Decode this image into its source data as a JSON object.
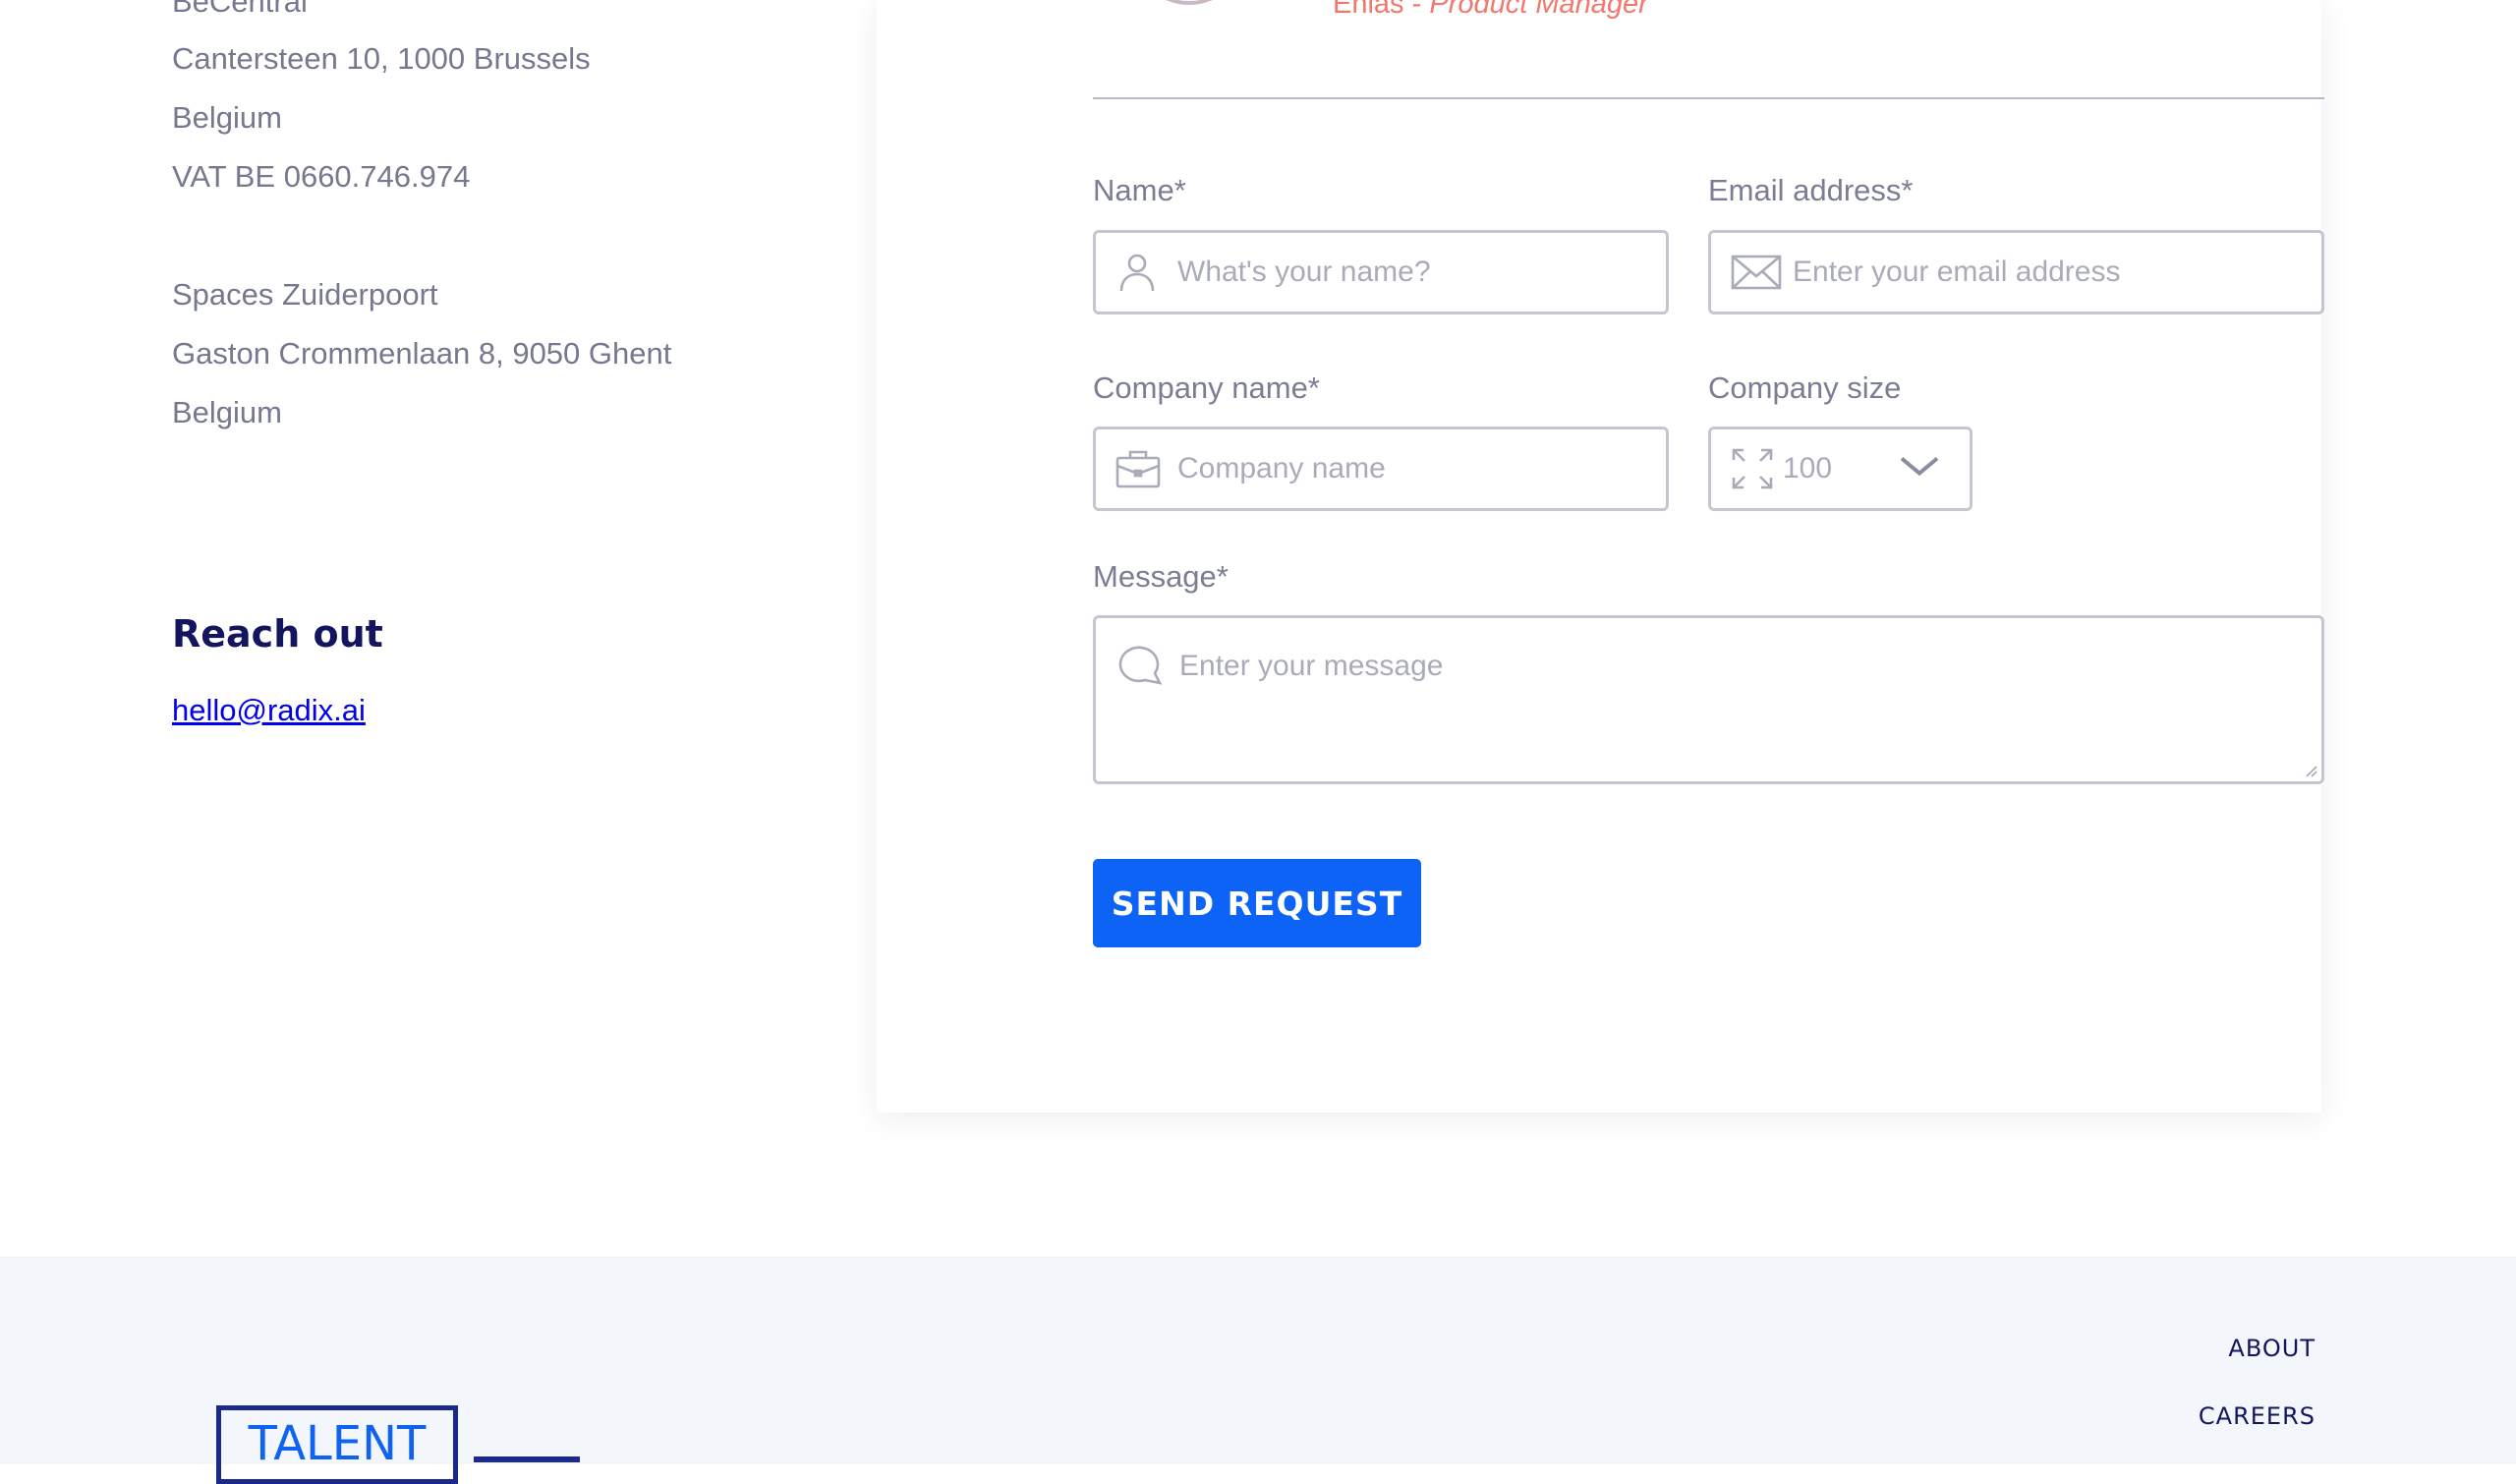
{
  "address": {
    "office1": [
      "BeCentral",
      "Cantersteen 10, 1000 Brussels",
      "Belgium",
      "VAT BE 0660.746.974"
    ],
    "office2": [
      "Spaces Zuiderpoort",
      "Gaston Crommenlaan 8, 9050 Ghent",
      "Belgium"
    ]
  },
  "reach_out": {
    "title": "Reach out",
    "email": "hello@radix.ai"
  },
  "contact_person": {
    "name": "Enias - ",
    "role": "Product Manager"
  },
  "form": {
    "name": {
      "label": "Name*",
      "placeholder": "What's your name?",
      "icon": "user-icon"
    },
    "email": {
      "label": "Email address*",
      "placeholder": "Enter your email address",
      "icon": "envelope-icon"
    },
    "company": {
      "label": "Company name*",
      "placeholder": "Company name",
      "icon": "briefcase-icon"
    },
    "size": {
      "label": "Company size",
      "value": "100",
      "icon": "expand-icon"
    },
    "message": {
      "label": "Message*",
      "placeholder": "Enter your message",
      "icon": "chat-bubble-icon"
    },
    "submit_label": "SEND REQUEST"
  },
  "footer": {
    "nav": [
      "ABOUT",
      "CAREERS"
    ],
    "logo_text": "TALENT"
  },
  "colors": {
    "accent_blue": "#0c63f5",
    "navy": "#13155e",
    "coral": "#f2776c",
    "muted_text": "#75788f"
  }
}
